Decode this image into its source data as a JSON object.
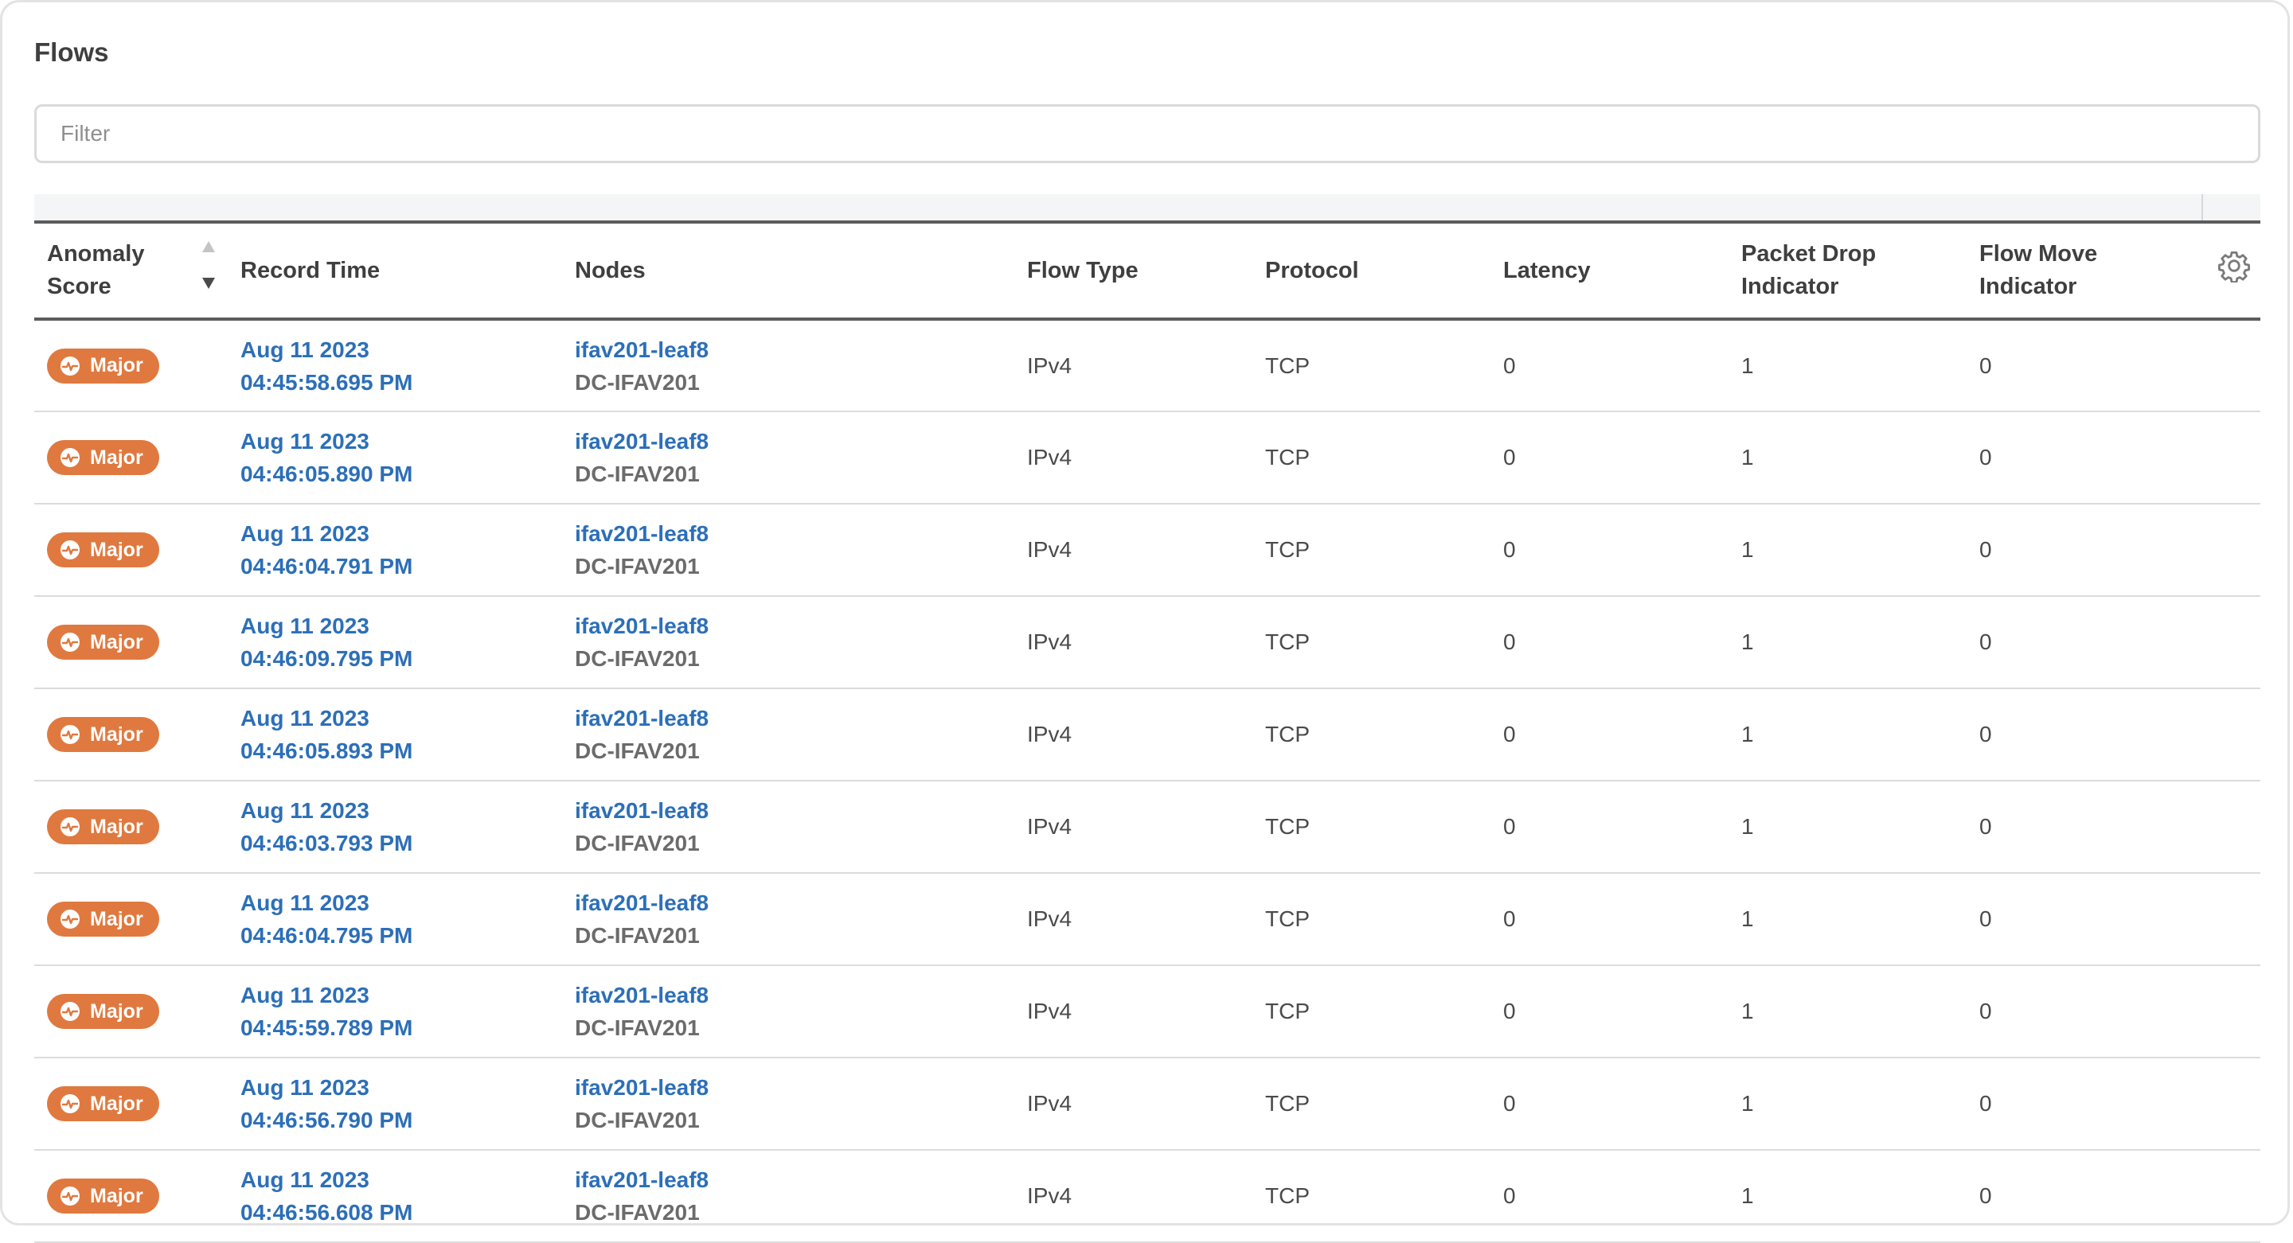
{
  "title": "Flows",
  "filter": {
    "placeholder": "Filter",
    "value": ""
  },
  "colors": {
    "accent_link": "#2c6fb8",
    "badge_major": "#e0793f"
  },
  "columns": [
    {
      "label_line1": "Anomaly",
      "label_line2": "Score"
    },
    {
      "label_line1": "Record Time",
      "label_line2": ""
    },
    {
      "label_line1": "Nodes",
      "label_line2": ""
    },
    {
      "label_line1": "Flow Type",
      "label_line2": ""
    },
    {
      "label_line1": "Protocol",
      "label_line2": ""
    },
    {
      "label_line1": "Latency",
      "label_line2": ""
    },
    {
      "label_line1": "Packet Drop",
      "label_line2": "Indicator"
    },
    {
      "label_line1": "Flow Move",
      "label_line2": "Indicator"
    }
  ],
  "sort": {
    "column": "Anomaly Score",
    "direction": "descending"
  },
  "settings_icon": "gear-icon",
  "rows": [
    {
      "score": "Major",
      "date": "Aug 11 2023",
      "time": "04:45:58.695 PM",
      "node": "ifav201-leaf8",
      "site": "DC-IFAV201",
      "flow_type": "IPv4",
      "protocol": "TCP",
      "latency": "0",
      "packet_drop": "1",
      "flow_move": "0"
    },
    {
      "score": "Major",
      "date": "Aug 11 2023",
      "time": "04:46:05.890 PM",
      "node": "ifav201-leaf8",
      "site": "DC-IFAV201",
      "flow_type": "IPv4",
      "protocol": "TCP",
      "latency": "0",
      "packet_drop": "1",
      "flow_move": "0"
    },
    {
      "score": "Major",
      "date": "Aug 11 2023",
      "time": "04:46:04.791 PM",
      "node": "ifav201-leaf8",
      "site": "DC-IFAV201",
      "flow_type": "IPv4",
      "protocol": "TCP",
      "latency": "0",
      "packet_drop": "1",
      "flow_move": "0"
    },
    {
      "score": "Major",
      "date": "Aug 11 2023",
      "time": "04:46:09.795 PM",
      "node": "ifav201-leaf8",
      "site": "DC-IFAV201",
      "flow_type": "IPv4",
      "protocol": "TCP",
      "latency": "0",
      "packet_drop": "1",
      "flow_move": "0"
    },
    {
      "score": "Major",
      "date": "Aug 11 2023",
      "time": "04:46:05.893 PM",
      "node": "ifav201-leaf8",
      "site": "DC-IFAV201",
      "flow_type": "IPv4",
      "protocol": "TCP",
      "latency": "0",
      "packet_drop": "1",
      "flow_move": "0"
    },
    {
      "score": "Major",
      "date": "Aug 11 2023",
      "time": "04:46:03.793 PM",
      "node": "ifav201-leaf8",
      "site": "DC-IFAV201",
      "flow_type": "IPv4",
      "protocol": "TCP",
      "latency": "0",
      "packet_drop": "1",
      "flow_move": "0"
    },
    {
      "score": "Major",
      "date": "Aug 11 2023",
      "time": "04:46:04.795 PM",
      "node": "ifav201-leaf8",
      "site": "DC-IFAV201",
      "flow_type": "IPv4",
      "protocol": "TCP",
      "latency": "0",
      "packet_drop": "1",
      "flow_move": "0"
    },
    {
      "score": "Major",
      "date": "Aug 11 2023",
      "time": "04:45:59.789 PM",
      "node": "ifav201-leaf8",
      "site": "DC-IFAV201",
      "flow_type": "IPv4",
      "protocol": "TCP",
      "latency": "0",
      "packet_drop": "1",
      "flow_move": "0"
    },
    {
      "score": "Major",
      "date": "Aug 11 2023",
      "time": "04:46:56.790 PM",
      "node": "ifav201-leaf8",
      "site": "DC-IFAV201",
      "flow_type": "IPv4",
      "protocol": "TCP",
      "latency": "0",
      "packet_drop": "1",
      "flow_move": "0"
    },
    {
      "score": "Major",
      "date": "Aug 11 2023",
      "time": "04:46:56.608 PM",
      "node": "ifav201-leaf8",
      "site": "DC-IFAV201",
      "flow_type": "IPv4",
      "protocol": "TCP",
      "latency": "0",
      "packet_drop": "1",
      "flow_move": "0"
    }
  ]
}
